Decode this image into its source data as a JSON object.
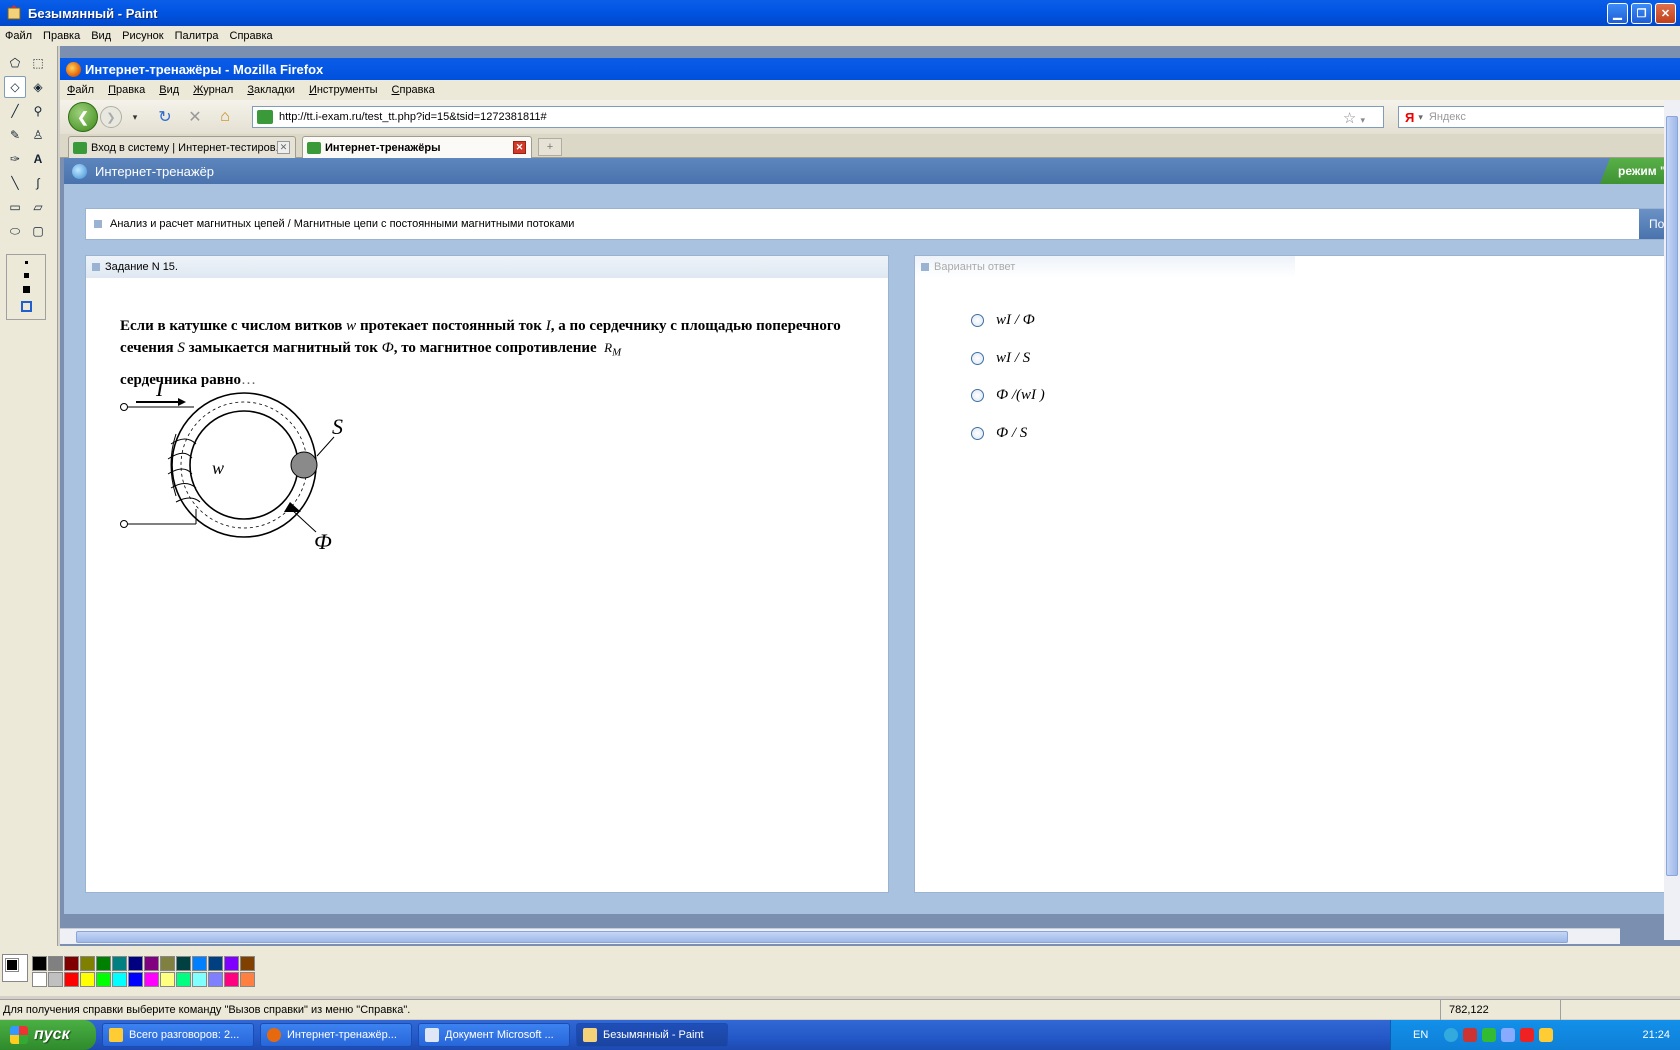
{
  "paint": {
    "title": "Безымянный - Paint",
    "menu": [
      "Файл",
      "Правка",
      "Вид",
      "Рисунок",
      "Палитра",
      "Справка"
    ],
    "status_text": "Для получения справки выберите команду \"Вызов справки\" из меню \"Справка\".",
    "coords": "782,122",
    "palette_top": [
      "#000000",
      "#808080",
      "#800000",
      "#808000",
      "#008000",
      "#008080",
      "#000080",
      "#800080",
      "#808040",
      "#004040",
      "#0080ff",
      "#004080",
      "#8000ff",
      "#804000"
    ],
    "palette_bottom": [
      "#ffffff",
      "#c0c0c0",
      "#ff0000",
      "#ffff00",
      "#00ff00",
      "#00ffff",
      "#0000ff",
      "#ff00ff",
      "#ffff80",
      "#00ff80",
      "#80ffff",
      "#8080ff",
      "#ff0080",
      "#ff8040"
    ]
  },
  "firefox": {
    "title": "Интернет-тренажёры - Mozilla Firefox",
    "menu": [
      "Файл",
      "Правка",
      "Вид",
      "Журнал",
      "Закладки",
      "Инструменты",
      "Справка"
    ],
    "url": "http://tt.i-exam.ru/test_tt.php?id=15&tsid=1272381811#",
    "search_placeholder": "Яндекс",
    "search_engine": "Я",
    "tabs": [
      {
        "label": "Вход в систему | Интернет-тестиров..."
      },
      {
        "label": "Интернет-тренажёры"
      }
    ]
  },
  "page": {
    "header_title": "Интернет-тренажёр",
    "mode_label": "режим \"С",
    "breadcrumb": "Анализ и расчет магнитных цепей / Магнитные цепи с постоянными магнитными потоками",
    "help_label": "Помо",
    "task_label": "Задание N 15.",
    "answers_label": "Варианты ответ",
    "question": {
      "part1": "Если в катушке с числом витков ",
      "w": "w",
      "part2": " протекает постоянный ток ",
      "i": "I",
      "part3": ", а по сердечнику с площадью поперечного сечения ",
      "s": "S",
      "part4": " замыкается магнитный ток ",
      "phi": "Ф",
      "part5": ", то магнитное сопротивление ",
      "rm": "R",
      "rm_sub": "M",
      "part6": " сердечника равно",
      "ellipsis": "…"
    },
    "figure_labels": {
      "i": "I",
      "s": "S",
      "w": "w",
      "phi": "Ф"
    },
    "options": [
      "wI / Ф",
      "wI / S",
      "Ф /(wI )",
      "Ф / S"
    ]
  },
  "taskbar": {
    "start_label": "пуск",
    "tasks": [
      "Всего разговоров: 2...",
      "Интернет-тренажёр...",
      "Документ Microsoft ...",
      "Безымянный - Paint"
    ],
    "lang": "EN",
    "clock": "21:24"
  }
}
